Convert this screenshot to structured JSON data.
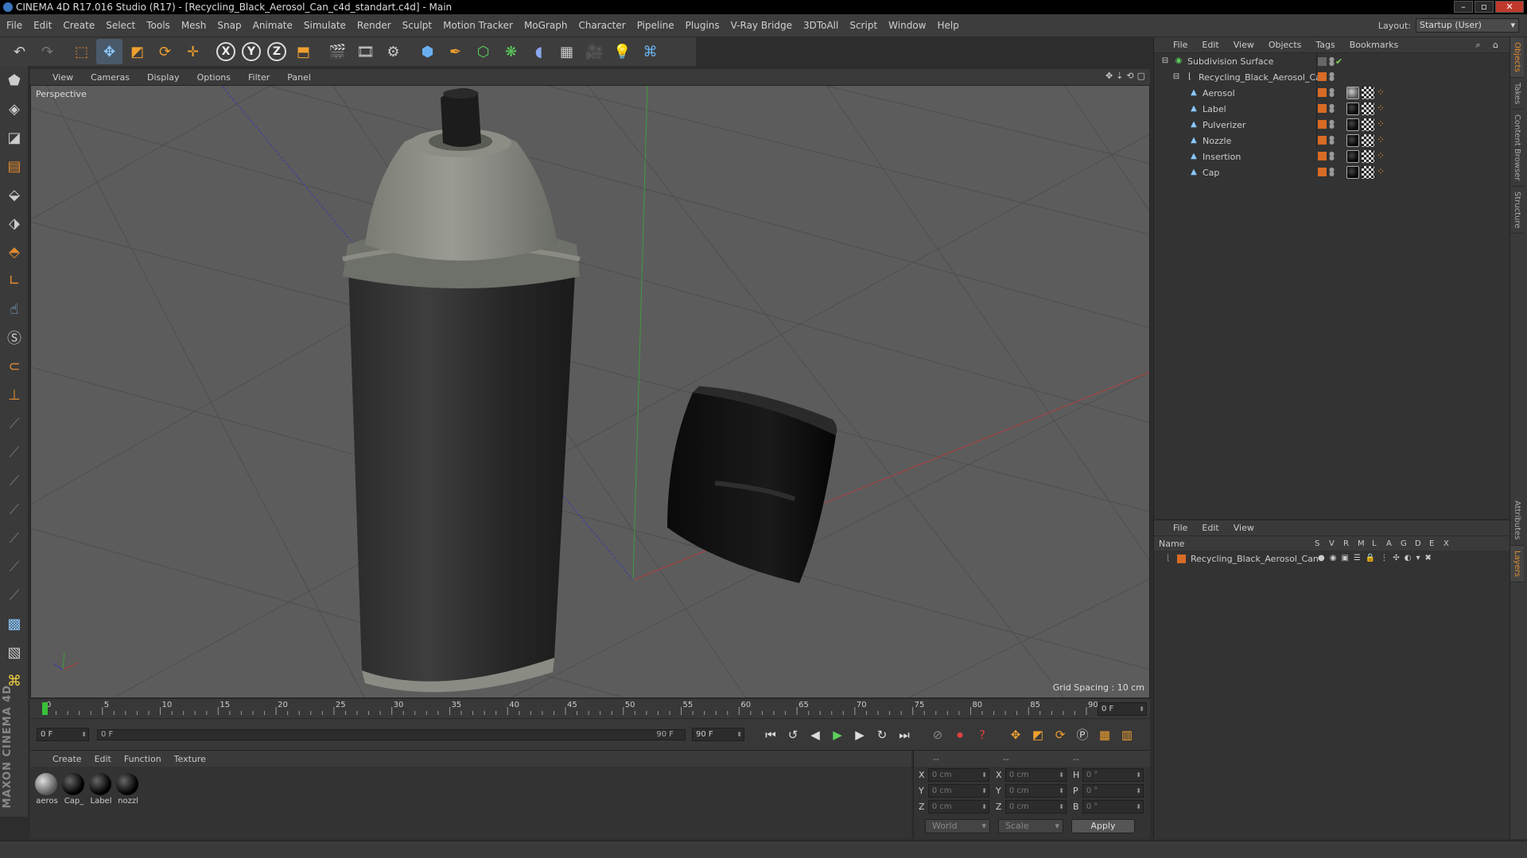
{
  "window": {
    "title": "CINEMA 4D R17.016 Studio (R17) - [Recycling_Black_Aerosol_Can_c4d_standart.c4d] - Main"
  },
  "menubar": {
    "items": [
      "File",
      "Edit",
      "Create",
      "Select",
      "Tools",
      "Mesh",
      "Snap",
      "Animate",
      "Simulate",
      "Render",
      "Sculpt",
      "Motion Tracker",
      "MoGraph",
      "Character",
      "Pipeline",
      "Plugins",
      "V-Ray Bridge",
      "3DToAll",
      "Script",
      "Window",
      "Help"
    ],
    "layout_label": "Layout:",
    "layout_value": "Startup (User)"
  },
  "toolbar": {
    "axis_x": "X",
    "axis_y": "Y",
    "axis_z": "Z"
  },
  "viewport": {
    "menu": [
      "View",
      "Cameras",
      "Display",
      "Options",
      "Filter",
      "Panel"
    ],
    "label": "Perspective",
    "grid_spacing": "Grid Spacing : 10 cm"
  },
  "timeline": {
    "ticks": [
      "0",
      "5",
      "10",
      "15",
      "20",
      "25",
      "30",
      "35",
      "40",
      "45",
      "50",
      "55",
      "60",
      "65",
      "70",
      "75",
      "80",
      "85",
      "90"
    ],
    "current_frame_right": "0 F",
    "start_frame": "0 F",
    "range_start": "0 F",
    "range_end": "90 F",
    "end_frame": "90 F"
  },
  "materials": {
    "menu": [
      "Create",
      "Edit",
      "Function",
      "Texture"
    ],
    "items": [
      {
        "name": "aeros",
        "style": "grey"
      },
      {
        "name": "Cap_",
        "style": "black"
      },
      {
        "name": "Label",
        "style": "black"
      },
      {
        "name": "nozzl",
        "style": "black"
      }
    ]
  },
  "coordinates": {
    "header": [
      "--",
      "--",
      "--"
    ],
    "rows": [
      {
        "a1": "X",
        "v1": "0 cm",
        "a2": "X",
        "v2": "0 cm",
        "a3": "H",
        "v3": "0 °"
      },
      {
        "a1": "Y",
        "v1": "0 cm",
        "a2": "Y",
        "v2": "0 cm",
        "a3": "P",
        "v3": "0 °"
      },
      {
        "a1": "Z",
        "v1": "0 cm",
        "a2": "Z",
        "v2": "0 cm",
        "a3": "B",
        "v3": "0 °"
      }
    ],
    "space": "World",
    "mode": "Scale",
    "apply": "Apply"
  },
  "object_manager": {
    "menu": [
      "File",
      "Edit",
      "View",
      "Objects",
      "Tags",
      "Bookmarks"
    ],
    "root": "Subdivision Surface",
    "group": "Recycling_Black_Aerosol_Can",
    "children": [
      {
        "name": "Aerosol",
        "tag": "lt"
      },
      {
        "name": "Label",
        "tag": ""
      },
      {
        "name": "Pulverizer",
        "tag": ""
      },
      {
        "name": "Nozzle",
        "tag": ""
      },
      {
        "name": "Insertion",
        "tag": ""
      },
      {
        "name": "Cap",
        "tag": ""
      }
    ]
  },
  "layer_manager": {
    "menu": [
      "File",
      "Edit",
      "View"
    ],
    "name_header": "Name",
    "columns": [
      "S",
      "V",
      "R",
      "M",
      "L",
      "A",
      "G",
      "D",
      "E",
      "X"
    ],
    "layer": "Recycling_Black_Aerosol_Can"
  },
  "side_tabs": [
    "Objects",
    "Takes",
    "Content Browser",
    "Structure",
    "Attributes",
    "Layers"
  ],
  "colors": {
    "accent": "#d86b25",
    "viewport_bg": "#5c5c5c",
    "panel_bg": "#333333"
  }
}
